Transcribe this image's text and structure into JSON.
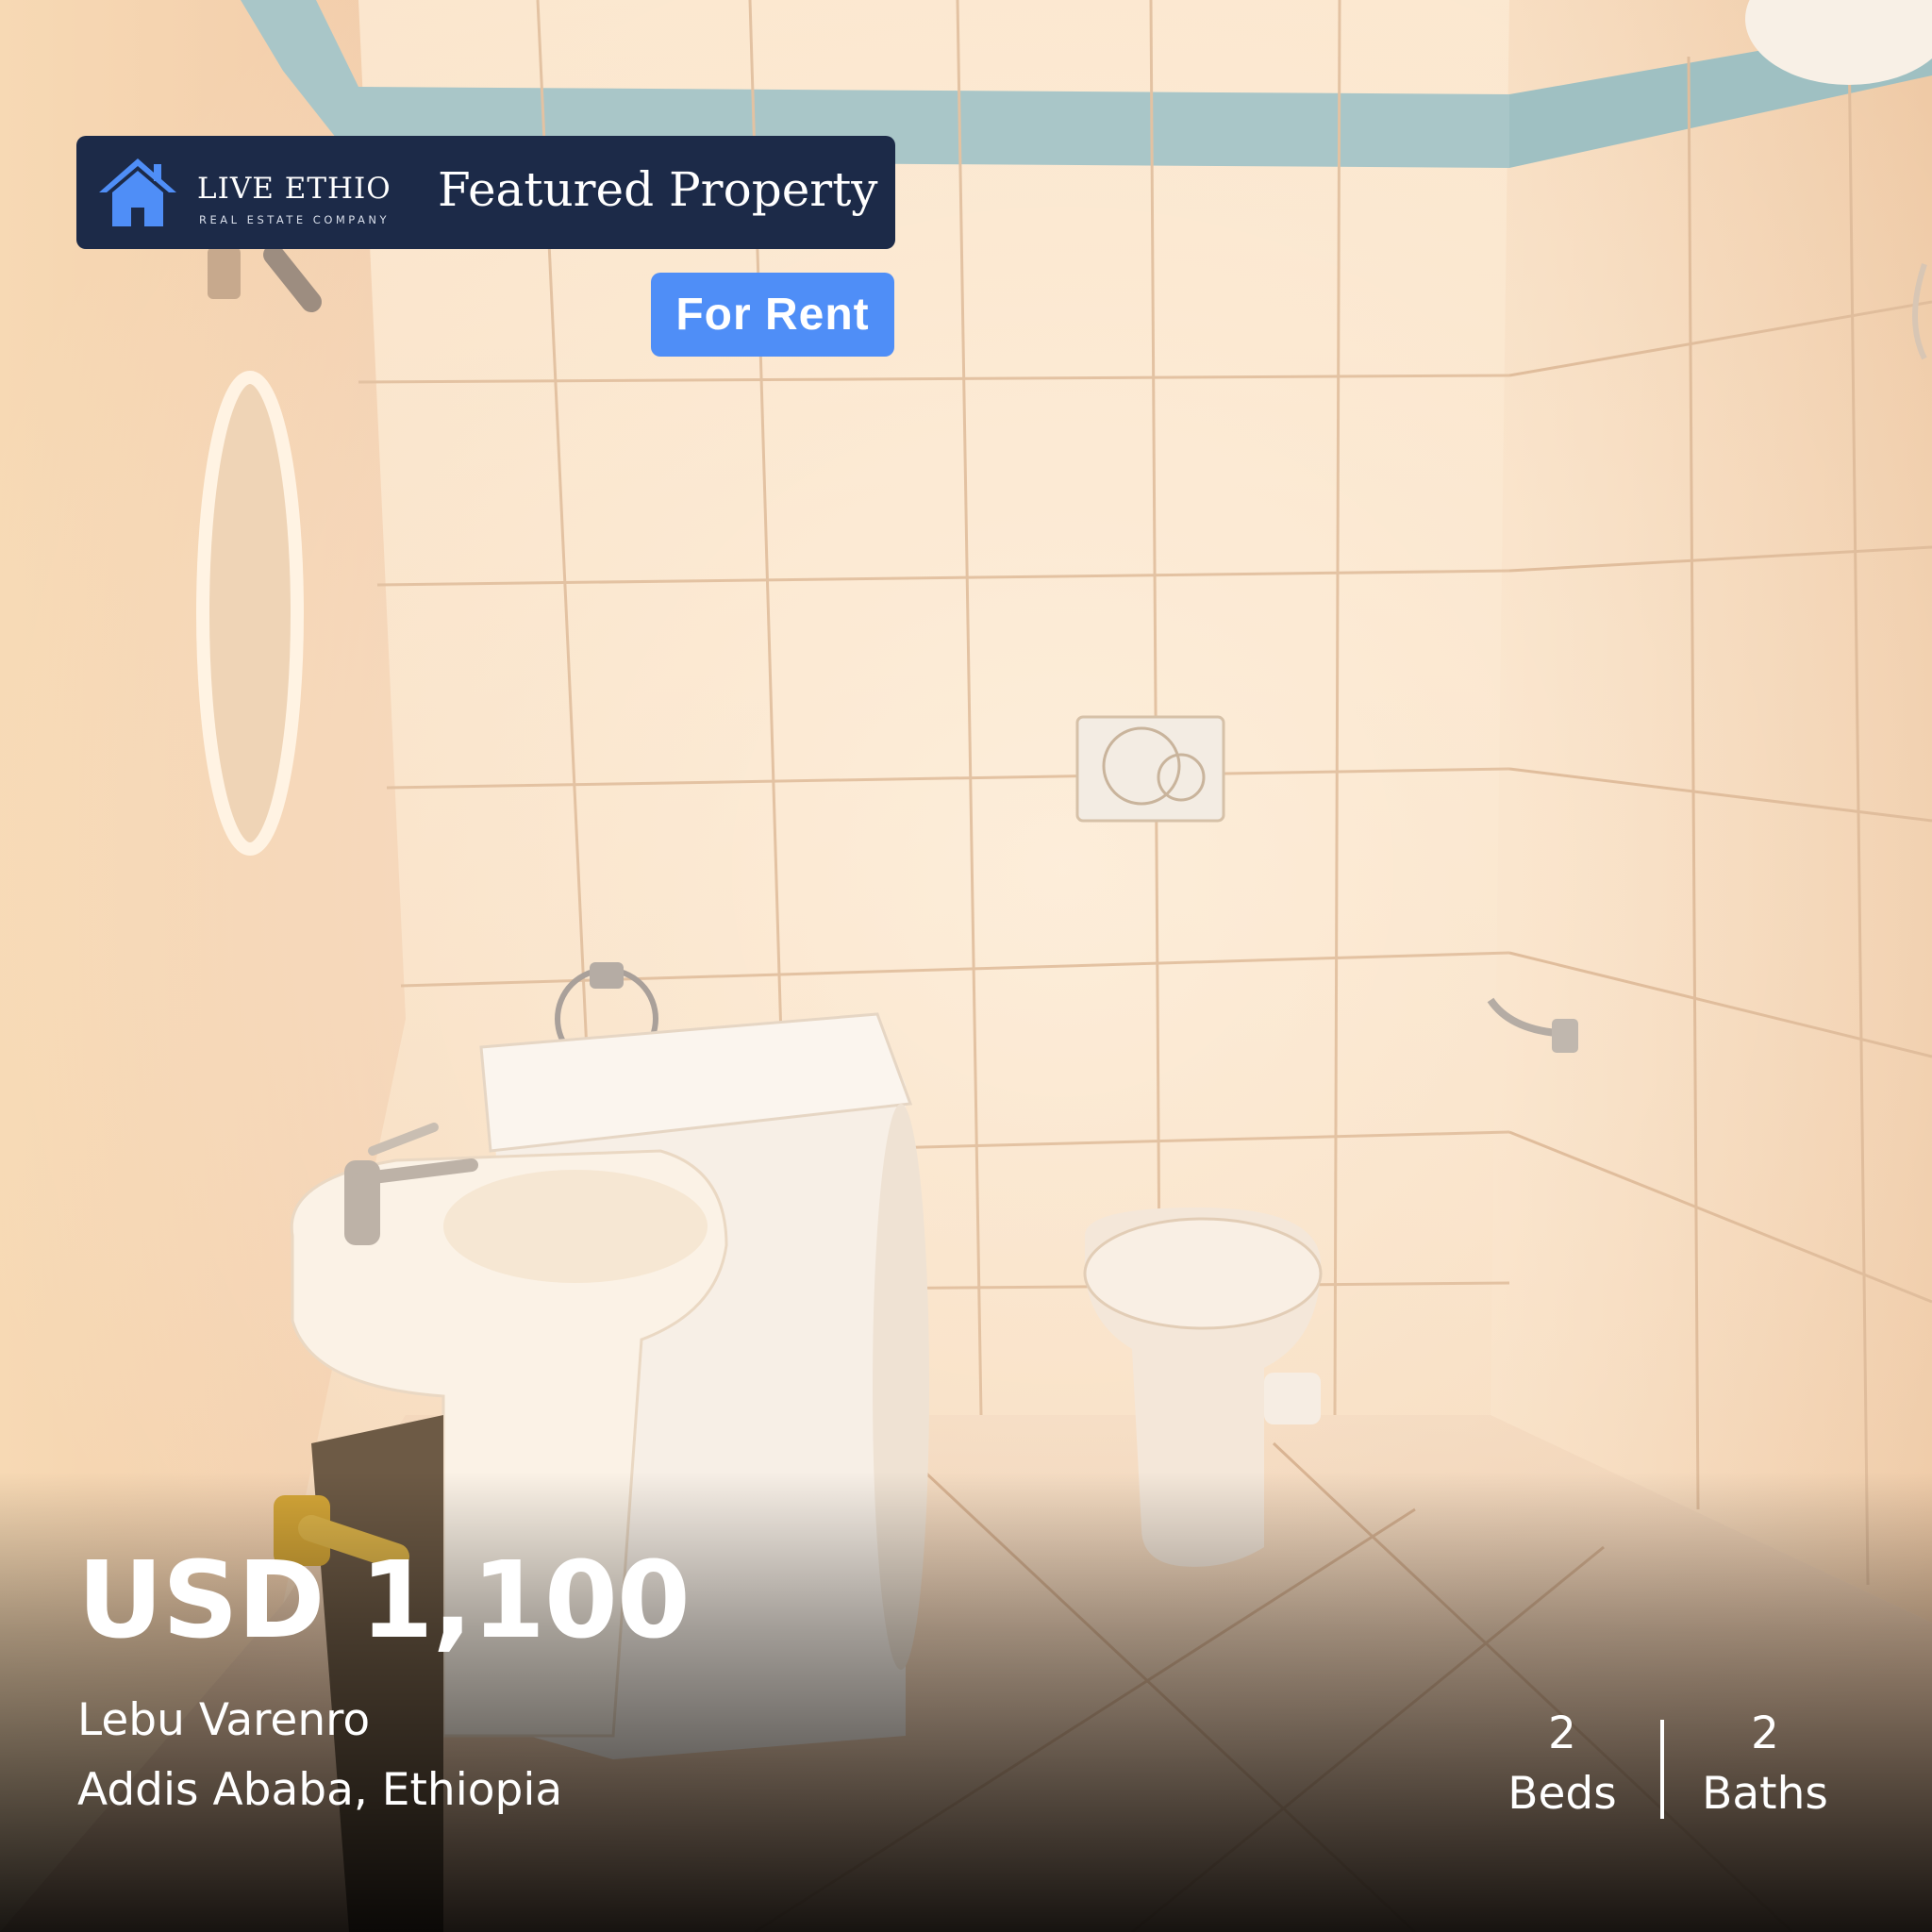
{
  "brand": {
    "name": "LIVE ETHIO",
    "tagline": "REAL ESTATE COMPANY",
    "accent": "#4f8ef7",
    "badge_bg": "#1c2a48"
  },
  "header": {
    "title": "Featured Property"
  },
  "listing": {
    "status": "For Rent",
    "price": "USD 1,100",
    "location_line1": "Lebu Varenro",
    "location_line2": "Addis Ababa, Ethiopia",
    "beds": {
      "count": "2",
      "label": "Beds"
    },
    "baths": {
      "count": "2",
      "label": "Baths"
    }
  },
  "photo": {
    "subject": "bathroom-interior",
    "icons": [
      "house-icon"
    ]
  }
}
